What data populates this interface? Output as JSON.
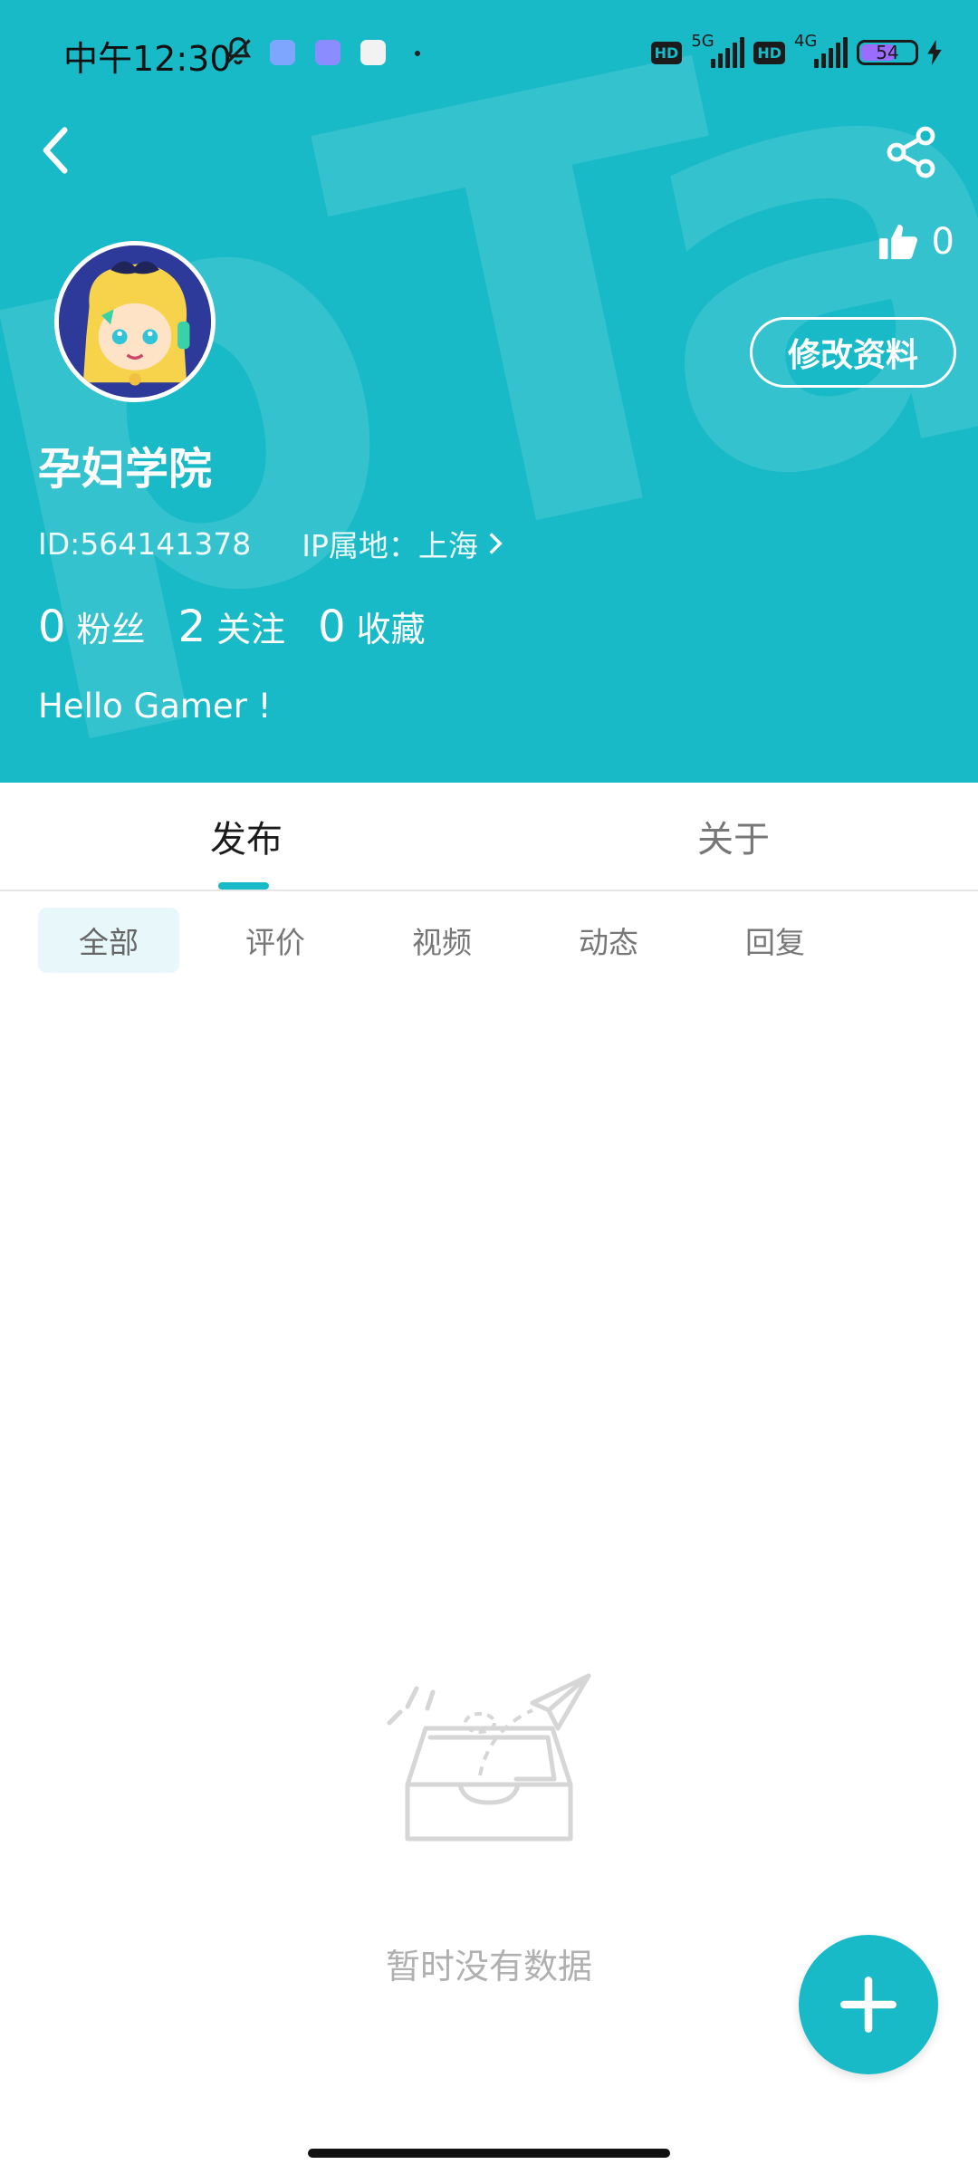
{
  "status_bar": {
    "time": "中午12:30",
    "net1_label": "5G",
    "net2_label": "4G",
    "hd1": "HD",
    "hd2": "HD",
    "battery": "54",
    "colors": {
      "battery_fill": "#9b6cff"
    }
  },
  "theme": {
    "accent": "#18BAC8",
    "header_bg": "#18BAC8"
  },
  "header": {
    "watermark": "pTa",
    "like_count": "0",
    "edit_label": "修改资料",
    "username": "孕妇学院",
    "id_text": "ID:564141378",
    "ip_text": "IP属地：上海",
    "stats": [
      {
        "num": "0",
        "label": "粉丝"
      },
      {
        "num": "2",
        "label": "关注"
      },
      {
        "num": "0",
        "label": "收藏"
      }
    ],
    "bio": "Hello Gamer !"
  },
  "tabs": {
    "publish": "发布",
    "about": "关于"
  },
  "filters": [
    "全部",
    "评价",
    "视频",
    "动态",
    "回复"
  ],
  "empty": {
    "text": "暂时没有数据"
  },
  "icons": [
    "back-icon",
    "share-icon",
    "thumbs-up-icon",
    "chevron-right-icon",
    "add-icon",
    "empty-inbox-icon"
  ]
}
